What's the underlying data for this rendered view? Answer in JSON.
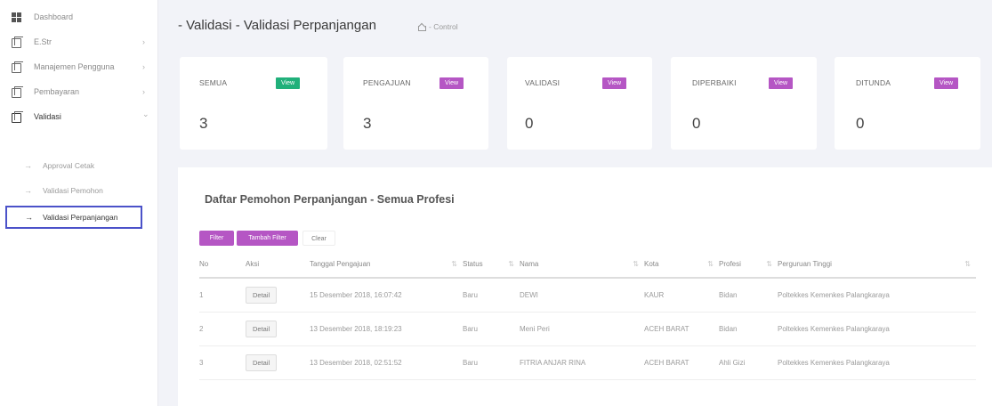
{
  "sidebar": {
    "items": [
      {
        "label": "Dashboard",
        "icon": "dashboard-icon",
        "has_chevron": false
      },
      {
        "label": "E.Str",
        "icon": "document-icon",
        "has_chevron": true
      },
      {
        "label": "Manajemen Pengguna",
        "icon": "document-icon",
        "has_chevron": true
      },
      {
        "label": "Pembayaran",
        "icon": "document-icon",
        "has_chevron": true
      },
      {
        "label": "Validasi",
        "icon": "document-icon",
        "has_chevron": true,
        "expanded": true
      }
    ],
    "sub_items": [
      {
        "label": "Approval Cetak"
      },
      {
        "label": "Validasi Pemohon"
      },
      {
        "label": "Validasi Perpanjangan",
        "active": true
      }
    ],
    "chevron_right": "›",
    "chevron_down": "⌄",
    "sub_arrow": "→"
  },
  "header": {
    "title": "- Validasi - Validasi Perpanjangan",
    "breadcrumb": "- Control"
  },
  "cards": [
    {
      "title": "SEMUA",
      "view_label": "View",
      "count": "3",
      "color": "#20b07a"
    },
    {
      "title": "PENGAJUAN",
      "view_label": "View",
      "count": "3",
      "color": "#b556c4"
    },
    {
      "title": "VALIDASI",
      "view_label": "View",
      "count": "0",
      "color": "#b556c4"
    },
    {
      "title": "DIPERBAIKI",
      "view_label": "View",
      "count": "0",
      "color": "#b556c4"
    },
    {
      "title": "DITUNDA",
      "view_label": "View",
      "count": "0",
      "color": "#b556c4"
    }
  ],
  "main": {
    "title": "Daftar Pemohon Perpanjangan - Semua Profesi",
    "buttons": {
      "filter": "Filter",
      "tambah_filter": "Tambah Filter",
      "clear": "Clear"
    },
    "columns": [
      "No",
      "Aksi",
      "Tanggal Pengajuan",
      "Status",
      "Nama",
      "Kota",
      "Profesi",
      "Perguruan Tinggi"
    ],
    "sort_icon": "⇅",
    "rows": [
      {
        "no": "1",
        "aksi": "Detail",
        "tanggal": "15 Desember 2018, 16:07:42",
        "status": "Baru",
        "nama": "DEWI",
        "kota": "KAUR",
        "profesi": "Bidan",
        "pt": "Poltekkes Kemenkes Palangkaraya"
      },
      {
        "no": "2",
        "aksi": "Detail",
        "tanggal": "13 Desember 2018, 18:19:23",
        "status": "Baru",
        "nama": "Meni Peri",
        "kota": "ACEH BARAT",
        "profesi": "Bidan",
        "pt": "Poltekkes Kemenkes Palangkaraya"
      },
      {
        "no": "3",
        "aksi": "Detail",
        "tanggal": "13 Desember 2018, 02:51:52",
        "status": "Baru",
        "nama": "FITRIA ANJAR RINA",
        "kota": "ACEH BARAT",
        "profesi": "Ahli Gizi",
        "pt": "Poltekkes Kemenkes Palangkaraya"
      }
    ]
  },
  "colors": {
    "accent_purple": "#b556c4",
    "accent_green": "#20b07a",
    "active_border": "#4b52c9"
  }
}
